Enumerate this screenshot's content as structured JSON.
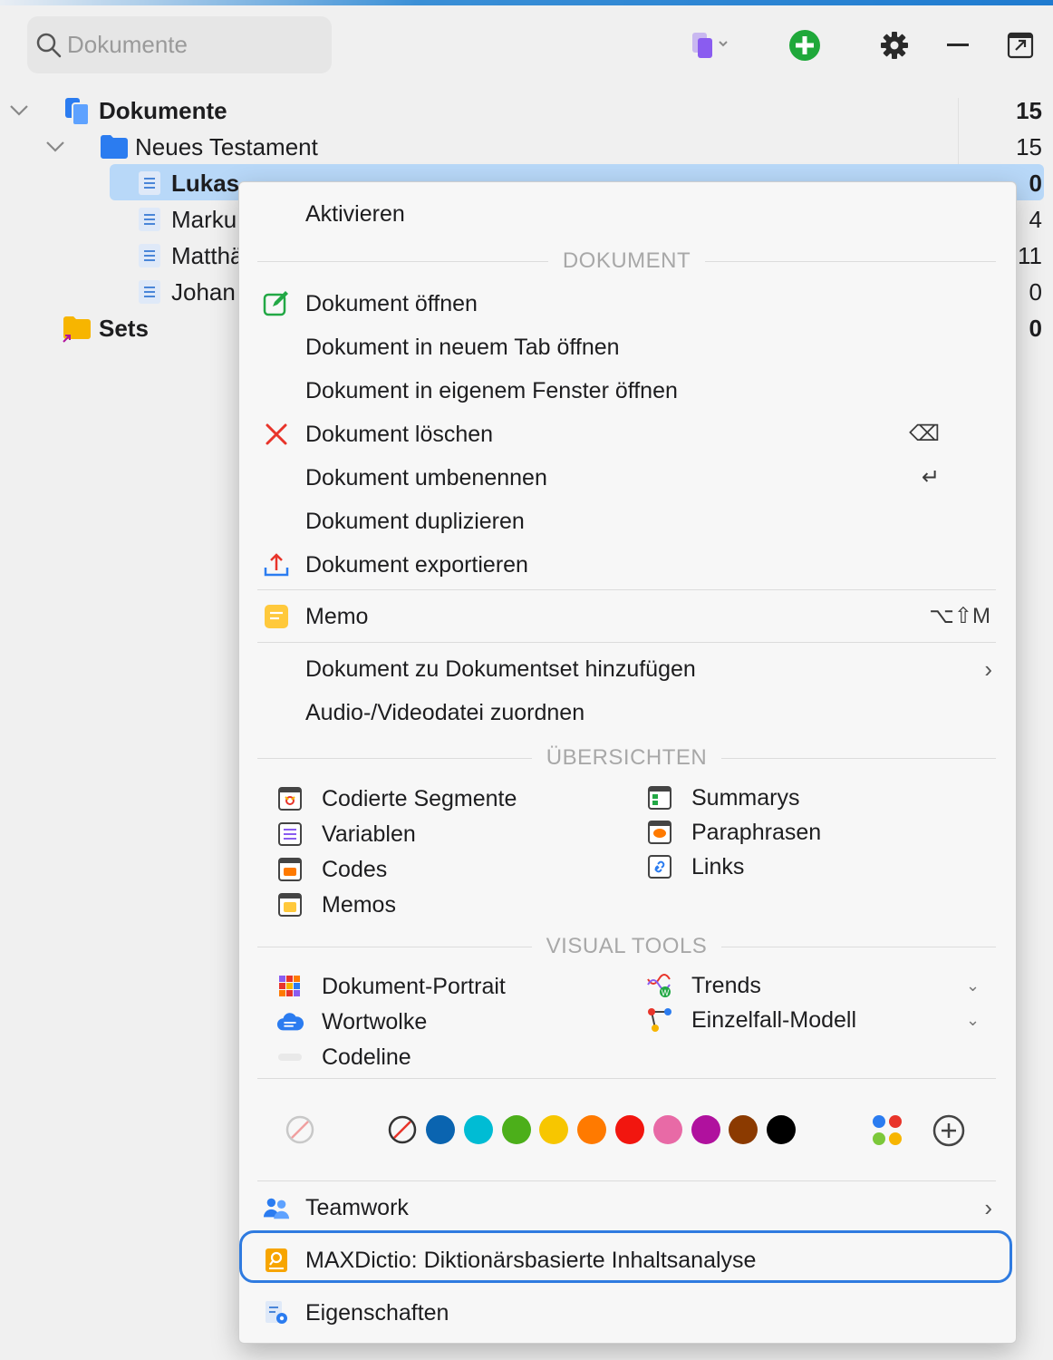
{
  "search": {
    "placeholder": "Dokumente"
  },
  "tree": {
    "root": {
      "label": "Dokumente",
      "count": "15"
    },
    "folder": {
      "label": "Neues Testament",
      "count": "15"
    },
    "docs": [
      {
        "label": "Lukas",
        "count": "0"
      },
      {
        "label": "Marku",
        "count": "4"
      },
      {
        "label": "Matthä",
        "count": "11"
      },
      {
        "label": "Johan",
        "count": "0"
      }
    ],
    "sets": {
      "label": "Sets",
      "count": "0"
    }
  },
  "menu": {
    "activate": "Aktivieren",
    "section_document": "DOKUMENT",
    "open": "Dokument öffnen",
    "open_tab": "Dokument in neuem Tab öffnen",
    "open_window": "Dokument in eigenem Fenster öffnen",
    "delete": "Dokument löschen",
    "delete_shortcut": "⌫",
    "rename": "Dokument umbenennen",
    "rename_shortcut": "↵",
    "duplicate": "Dokument duplizieren",
    "export": "Dokument exportieren",
    "memo": "Memo",
    "memo_shortcut": "⌥⇧M",
    "add_to_set": "Dokument zu Dokumentset hinzufügen",
    "assign_media": "Audio-/Videodatei zuordnen",
    "section_overviews": "ÜBERSICHTEN",
    "overviews_left": [
      "Codierte Segmente",
      "Variablen",
      "Codes",
      "Memos"
    ],
    "overviews_right": [
      "Summarys",
      "Paraphrasen",
      "Links"
    ],
    "section_visual": "VISUAL TOOLS",
    "visual_left": [
      "Dokument-Portrait",
      "Wortwolke",
      "Codeline"
    ],
    "visual_right": [
      "Trends",
      "Einzelfall-Modell"
    ],
    "teamwork": "Teamwork",
    "maxdictio": "MAXDictio: Diktionärsbasierte Inhaltsanalyse",
    "properties": "Eigenschaften"
  },
  "colors": {
    "accent": "#2f7be0",
    "swatches": [
      "#0a64b0",
      "#00bcd4",
      "#4caf1a",
      "#f7c600",
      "#ff7a00",
      "#f2160f",
      "#e86aa6",
      "#b0119e",
      "#8b3a00",
      "#000000"
    ]
  }
}
